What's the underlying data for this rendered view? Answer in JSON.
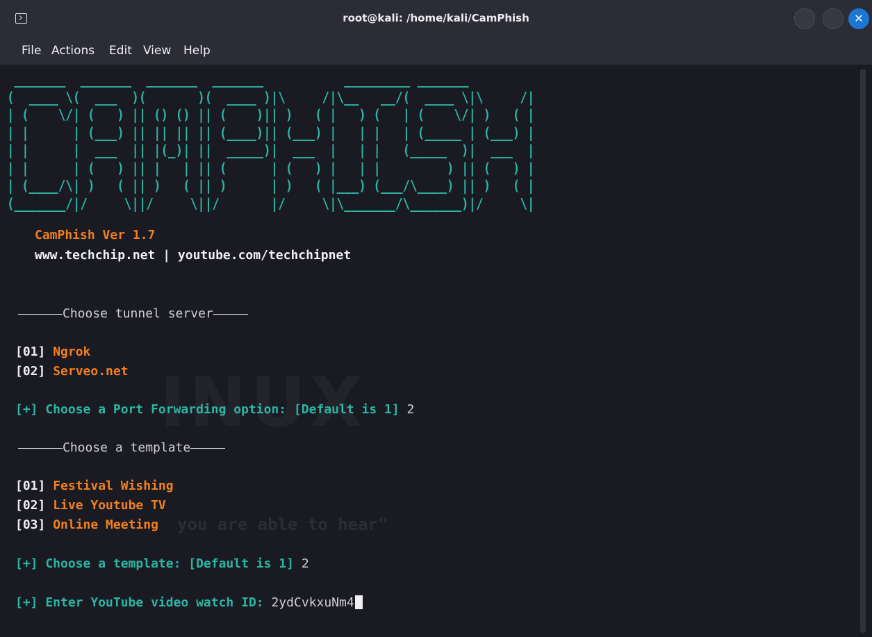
{
  "window": {
    "title": "root@kali: /home/kali/CamPhish",
    "close_glyph": "✕"
  },
  "menu": [
    "File",
    "Actions",
    "Edit",
    "View",
    "Help"
  ],
  "wallpaper": {
    "logo": "INUX",
    "quote": "you are able to hear\""
  },
  "banner": {
    "ascii_art": " _______  _______  _______  _______           _________ _______          \n(  ____ \\(  ___  )(       )(  ____ )|\\     /|\\__   __/(  ____ \\|\\     /|\n| (    \\/| (   ) || () () || (    )|| )   ( |   ) (   | (    \\/| )   ( |\n| |      | (___) || || || || (____)|| (___) |   | |   | (_____ | (___) |\n| |      |  ___  || |(_)| ||  _____)|  ___  |   | |   (_____  )|  ___  |\n| |      | (   ) || |   | || (      | (   ) |   | |         ) || (   ) |\n| (____/\\| )   ( || )   ( || )      | )   ( |___) (___/\\____) || )   ( |\n(_______/|/     \\||/     \\||/       |/     \\|\\_______/\\_______)|/     \\|",
    "version": "CamPhish Ver 1.7",
    "links": "www.techchip.net | youtube.com/techchipnet"
  },
  "tunnel": {
    "heading": "Choose tunnel server",
    "options": [
      {
        "num": "[01]",
        "label": "Ngrok"
      },
      {
        "num": "[02]",
        "label": "Serveo.net"
      }
    ],
    "prompt": "[+] Choose a Port Forwarding option: [Default is 1]",
    "answer": "2"
  },
  "template": {
    "heading": "Choose a template",
    "options": [
      {
        "num": "[01]",
        "label": "Festival Wishing"
      },
      {
        "num": "[02]",
        "label": "Live Youtube TV"
      },
      {
        "num": "[03]",
        "label": "Online Meeting"
      }
    ],
    "prompt": "[+] Choose a template: [Default is 1]",
    "answer": "2"
  },
  "youtube": {
    "prompt": "[+] Enter YouTube video watch ID:",
    "value": "2ydCvkxuNm4"
  },
  "colors": {
    "teal": "#2bb5a5",
    "orange": "#f27f20",
    "background": "#1a1b22",
    "close_button": "#1b76d4"
  }
}
